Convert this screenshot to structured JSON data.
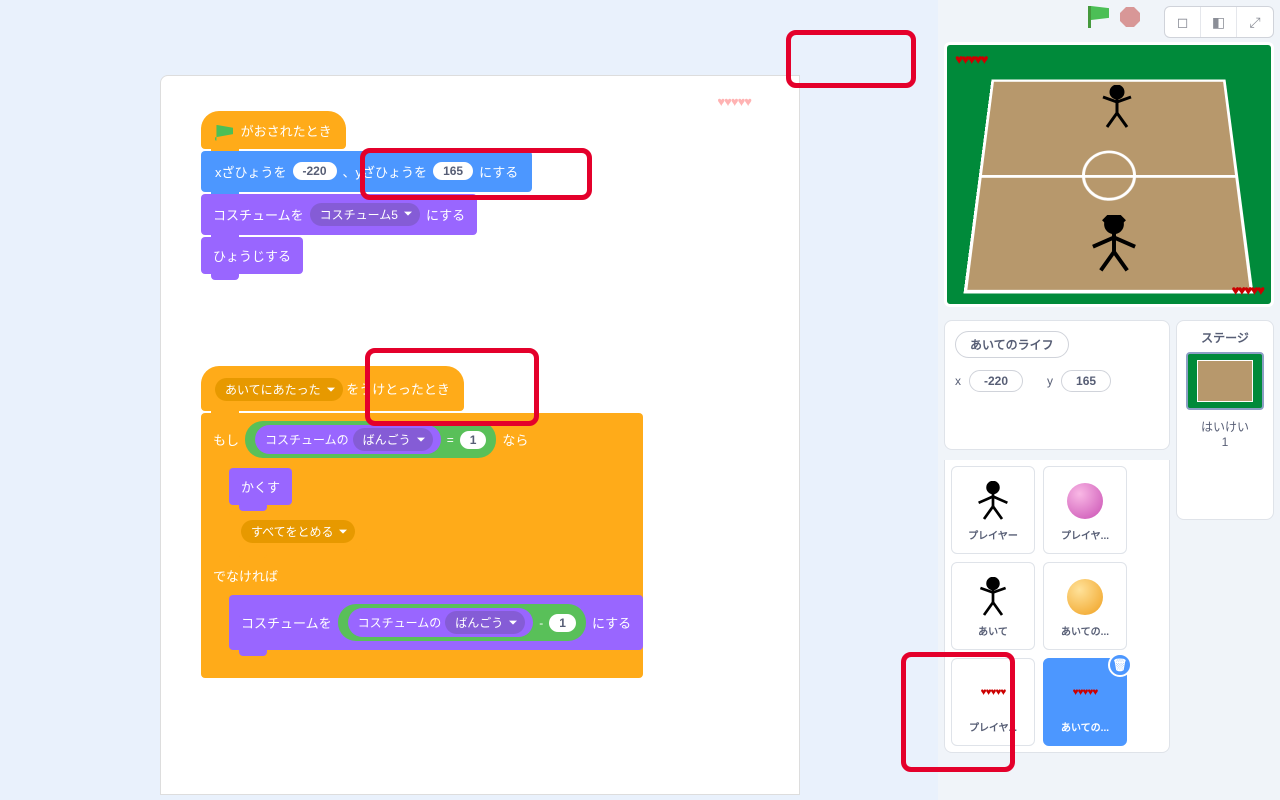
{
  "hearts5": "♥♥♥♥♥",
  "script1": {
    "hat": "がおされたとき",
    "goto_pre": "xざひょうを",
    "goto_x": "-220",
    "goto_mid": "、yざひょうを",
    "goto_y": "165",
    "goto_suf": "にする",
    "costume_pre": "コスチュームを",
    "costume_val": "コスチューム5",
    "costume_suf": "にする",
    "show": "ひょうじする"
  },
  "script2": {
    "hat_msg": "あいてにあたった",
    "hat_suf": "をうけとったとき",
    "if_pre": "もし",
    "if_suf": "なら",
    "eq_right": "1",
    "costnum_pre": "コスチュームの",
    "costnum_val": "ばんごう",
    "hide": "かくす",
    "stopall": "すべてをとめる",
    "else": "でなければ",
    "setcost_pre": "コスチュームを",
    "minus_right": "1",
    "setcost_suf": "にする"
  },
  "sprite_info": {
    "name": "あいてのライフ",
    "x_label": "x",
    "x_val": "-220",
    "y_label": "y",
    "y_val": "165"
  },
  "stage_panel": {
    "title": "ステージ",
    "backdrop_label": "はいけい",
    "count": "1"
  },
  "sprites": {
    "player": "プレイヤー",
    "playerball": "プレイヤ...",
    "opponent": "あいて",
    "opponentball": "あいての...",
    "playerlife": "プレイヤ...",
    "opponentlife": "あいての..."
  }
}
